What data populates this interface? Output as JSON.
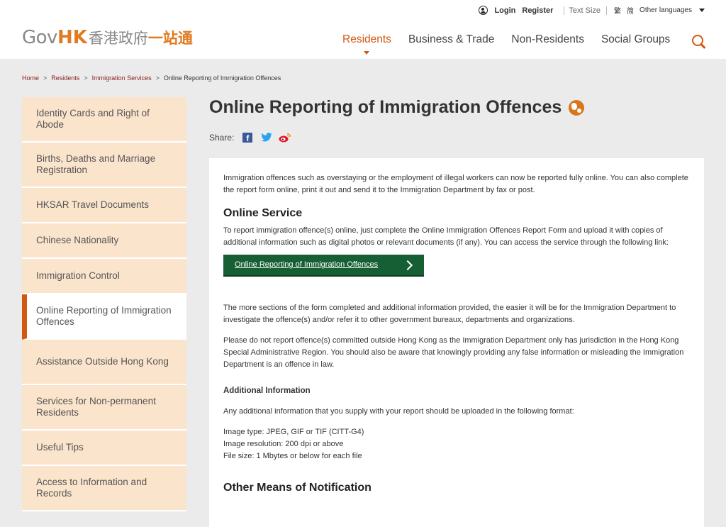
{
  "header": {
    "util": {
      "login": "Login",
      "register": "Register",
      "text_size": "Text Size",
      "lang_trad": "繁",
      "lang_simp": "简",
      "other_languages": "Other languages"
    },
    "logo": {
      "gov": "Gov",
      "hk": "HK",
      "cn_part1": "香港政府",
      "cn_part2": "一站通"
    },
    "nav": [
      {
        "label": "Residents",
        "active": true
      },
      {
        "label": "Business & Trade",
        "active": false
      },
      {
        "label": "Non-Residents",
        "active": false
      },
      {
        "label": "Social Groups",
        "active": false
      }
    ]
  },
  "breadcrumb": [
    "Home",
    "Residents",
    "Immigration Services",
    "Online Reporting of Immigration Offences"
  ],
  "sidebar": {
    "items": [
      {
        "label": "Identity Cards and Right of Abode"
      },
      {
        "label": "Births, Deaths and Marriage Registration"
      },
      {
        "label": "HKSAR Travel Documents"
      },
      {
        "label": "Chinese Nationality"
      },
      {
        "label": "Immigration Control"
      },
      {
        "label": "Online Reporting of Immigration Offences",
        "active": true
      },
      {
        "label": "Assistance Outside Hong Kong"
      },
      {
        "label": "Services for Non-permanent Residents"
      },
      {
        "label": "Useful Tips"
      },
      {
        "label": "Access to Information and Records"
      }
    ]
  },
  "main": {
    "title": "Online Reporting of Immigration Offences",
    "share_label": "Share:",
    "intro": "Immigration offences such as overstaying or the employment of illegal workers can now be reported fully online. You can also complete the report form online, print it out and send it to the Immigration Department by fax or post.",
    "online_service_heading": "Online Service",
    "online_service_text": "To report immigration offence(s) online, just complete the Online Immigration Offences Report Form and upload it with copies of additional information such as digital photos or relevant documents (if any). You can access the service through the following link:",
    "button_label": "Online Reporting of Immigration Offences",
    "para2": "The more sections of the form completed and additional information provided, the easier it will be for the Immigration Department to investigate the offence(s) and/or refer it to other government bureaux, departments and organizations.",
    "para3": "Please do not report offence(s) committed outside Hong Kong as the Immigration Department only has jurisdiction in the Hong Kong Special Administrative Region. You should also be aware that knowingly providing any false information or misleading the Immigration Department is an offence in law.",
    "additional_heading": "Additional Information",
    "additional_text": "Any additional information that you supply with your report should be uploaded in the following format:",
    "format_lines": [
      "Image type: JPEG, GIF or TIF (CITT-G4)",
      "Image resolution: 200 dpi or above",
      "File size: 1 Mbytes or below for each file"
    ],
    "other_heading": "Other Means of Notification"
  },
  "colors": {
    "accent": "#d25812",
    "button_bg": "#165e33",
    "sidebar_bg": "#fbe4cc"
  }
}
